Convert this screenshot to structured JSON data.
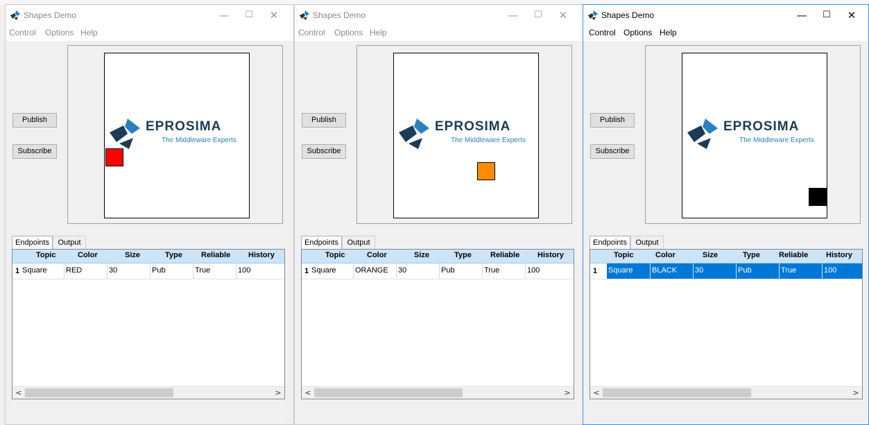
{
  "windows": [
    {
      "title": "Shapes Demo",
      "menu": [
        "Control",
        "Options",
        "Help"
      ],
      "publish_label": "Publish",
      "subscribe_label": "Subscribe",
      "logo_word": "EPROSIMA",
      "logo_tagline": "The Middleware Experts",
      "shape_color": "#ff0000",
      "tabs": [
        "Endpoints",
        "Output"
      ],
      "columns": [
        "Topic",
        "Color",
        "Size",
        "Type",
        "Reliable",
        "History"
      ],
      "row": {
        "num": "1",
        "topic": "Square",
        "color": "RED",
        "size": "30",
        "type": "Pub",
        "reliable": "True",
        "history": "100"
      },
      "active": false
    },
    {
      "title": "Shapes Demo",
      "menu": [
        "Control",
        "Options",
        "Help"
      ],
      "publish_label": "Publish",
      "subscribe_label": "Subscribe",
      "logo_word": "EPROSIMA",
      "logo_tagline": "The Middleware Experts",
      "shape_color": "#ff8c00",
      "tabs": [
        "Endpoints",
        "Output"
      ],
      "columns": [
        "Topic",
        "Color",
        "Size",
        "Type",
        "Reliable",
        "History"
      ],
      "row": {
        "num": "1",
        "topic": "Square",
        "color": "ORANGE",
        "size": "30",
        "type": "Pub",
        "reliable": "True",
        "history": "100"
      },
      "active": false
    },
    {
      "title": "Shapes Demo",
      "menu": [
        "Control",
        "Options",
        "Help"
      ],
      "publish_label": "Publish",
      "subscribe_label": "Subscribe",
      "logo_word": "EPROSIMA",
      "logo_tagline": "The Middleware Experts",
      "shape_color": "#000000",
      "tabs": [
        "Endpoints",
        "Output"
      ],
      "columns": [
        "Topic",
        "Color",
        "Size",
        "Type",
        "Reliable",
        "History"
      ],
      "row": {
        "num": "1",
        "topic": "Square",
        "color": "BLACK",
        "size": "30",
        "type": "Pub",
        "reliable": "True",
        "history": "100"
      },
      "active": true
    }
  ],
  "controls": {
    "minimize": "—",
    "maximize": "☐",
    "close": "✕"
  },
  "scroll": {
    "left": "<",
    "right": ">"
  }
}
